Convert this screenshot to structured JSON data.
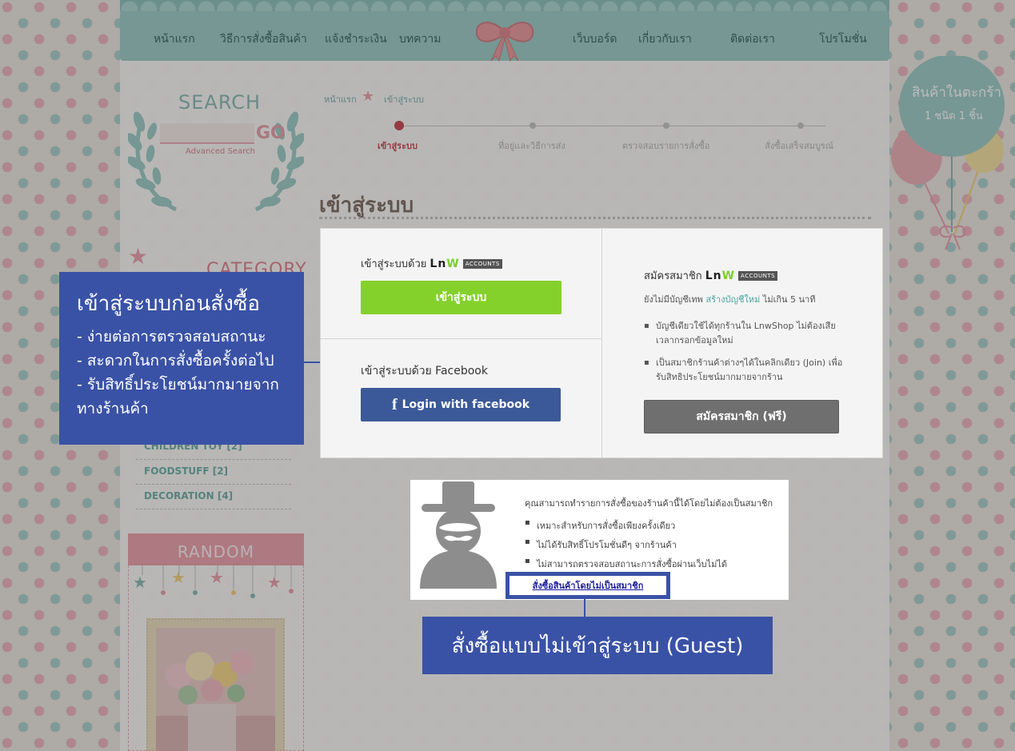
{
  "nav": {
    "items": [
      "หน้าแรก",
      "วิธีการสั่งซื้อสินค้า",
      "แจ้งชำระเงิน",
      "บทความ",
      "เว็บบอร์ด",
      "เกี่ยวกับเรา",
      "ติดต่อเรา",
      "โปรโมชั่น"
    ]
  },
  "sidebar": {
    "search_title": "SEARCH",
    "search_go": "GO",
    "advanced_search": "Advanced Search",
    "category_title": "CATEGORY",
    "categories": [
      "CHILDREN TOY [2]",
      "FOODSTUFF [2]",
      "DECORATION [4]"
    ],
    "random_title": "RANDOM"
  },
  "cart": {
    "title": "สินค้าในตะกร้า",
    "count": "1 ชนิด 1 ชิ้น"
  },
  "breadcrumb": {
    "home": "หน้าแรก",
    "current": "เข้าสู่ระบบ"
  },
  "steps": [
    "เข้าสู่ระบบ",
    "ที่อยู่และวิธีการส่ง",
    "ตรวจสอบรายการสั่งซื้อ",
    "สั่งซื้อเสร็จสมบูรณ์"
  ],
  "page_title": "เข้าสู่ระบบ",
  "login": {
    "lnw_label": "เข้าสู่ระบบด้วย",
    "lnw_logo_l": "Ln",
    "lnw_logo_w": "W",
    "lnw_badge": "ACCOUNTS",
    "login_button": "เข้าสู่ระบบ",
    "fb_label": "เข้าสู่ระบบด้วย Facebook",
    "fb_icon": "f",
    "fb_button": "Login with facebook"
  },
  "register": {
    "label": "สมัครสมาชิก",
    "no_account_prefix": "ยังไม่มีบัญชีเทพ",
    "create_link": "สร้างบัญชีใหม่",
    "no_account_suffix": "ไม่เกิน 5 นาที",
    "benefits": [
      "บัญชีเดียวใช้ได้ทุกร้านใน LnwShop ไม่ต้องเสียเวลากรอกข้อมูลใหม่",
      "เป็นสมาชิกร้านค้าต่างๆได้ในคลิกเดียว (Join) เพื่อรับสิทธิประโยชน์มากมายจากร้าน"
    ],
    "button": "สมัครสมาชิก (ฟรี)"
  },
  "guest": {
    "head": "คุณสามารถทำรายการสั่งซื้อของร้านค้านี้ได้โดยไม่ต้องเป็นสมาชิก",
    "items": [
      "เหมาะสำหรับการสั่งซื้อเพียงครั้งเดียว",
      "ไม่ได้รับสิทธิ์โปรโมชั่นดีๆ จากร้านค้า",
      "ไม่สามารถตรวจสอบสถานะการสั่งซื้อผ่านเว็บไม่ได้"
    ],
    "link": "สั่งซื้อสินค้าโดยไม่เป็นสมาชิก"
  },
  "callouts": {
    "left_head": "เข้าสู่ระบบก่อนสั่งซื้อ",
    "left_lines": [
      "- ง่ายต่อการตรวจสอบสถานะ",
      "- สะดวกในการสั่งซื้อครั้งต่อไป",
      "- รับสิทธิ์ประโยชน์มากมายจาก",
      "ทางร้านค้า"
    ],
    "bottom": "สั่งซื้อแบบไม่เข้าสู่ระบบ (Guest)"
  },
  "colors": {
    "accent_blue": "#3a52a6",
    "login_green": "#84d12c",
    "facebook_blue": "#3b5998",
    "register_gray": "#6f6f6f",
    "step_active": "#c0303a"
  }
}
